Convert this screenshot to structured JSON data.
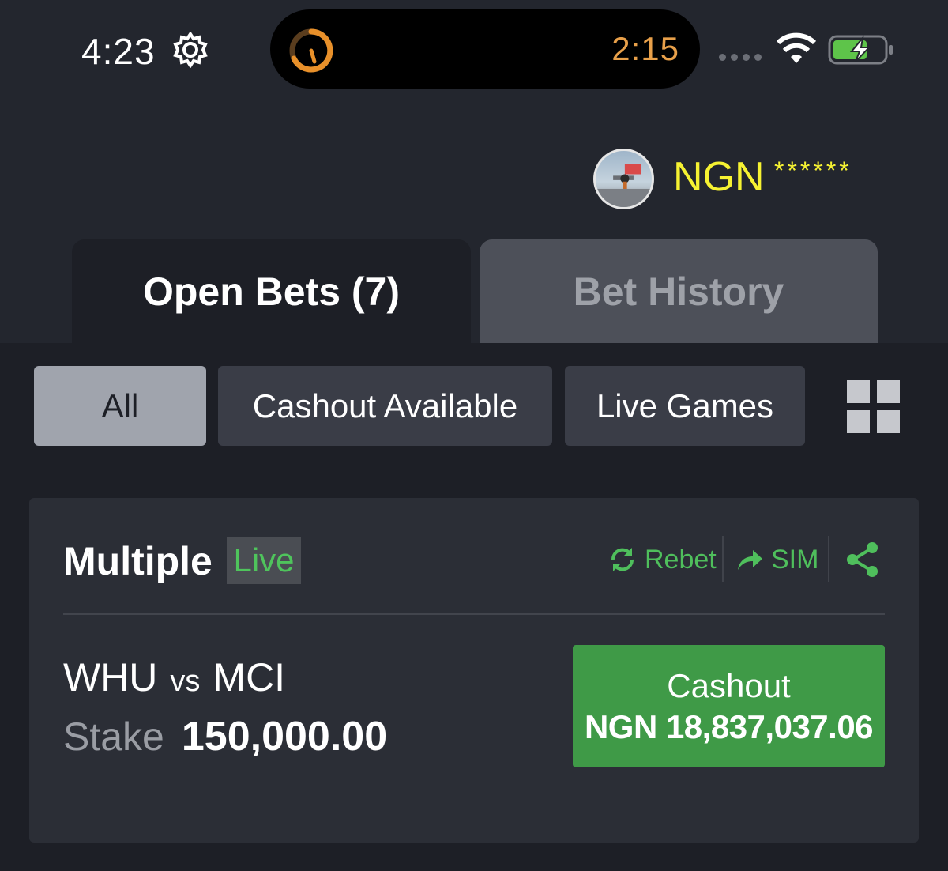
{
  "status_bar": {
    "time": "4:23",
    "activity_timer": "2:15",
    "icons": [
      "gear-icon",
      "timer-ring-icon",
      "signal-icon",
      "wifi-icon",
      "battery-charging-icon"
    ]
  },
  "account": {
    "currency": "NGN",
    "balance_masked": "******"
  },
  "tabs": [
    {
      "label": "Open Bets (7)",
      "active": true
    },
    {
      "label": "Bet History",
      "active": false
    }
  ],
  "filters": [
    {
      "label": "All",
      "selected": true
    },
    {
      "label": "Cashout Available",
      "selected": false
    },
    {
      "label": "Live Games",
      "selected": false
    }
  ],
  "bet": {
    "type": "Multiple",
    "live_label": "Live",
    "actions": {
      "rebet": "Rebet",
      "sim": "SIM"
    },
    "home": "WHU",
    "vs": "vs",
    "away": "MCI",
    "stake_label": "Stake",
    "stake_amount": "150,000.00",
    "cashout_label": "Cashout",
    "cashout_amount": "NGN 18,837,037.06"
  },
  "colors": {
    "background": "#23262e",
    "panel": "#1d1f26",
    "card": "#2b2e36",
    "accent_green": "#4fbf5c",
    "cashout_green": "#3f9a47",
    "balance_yellow": "#f6f232"
  }
}
